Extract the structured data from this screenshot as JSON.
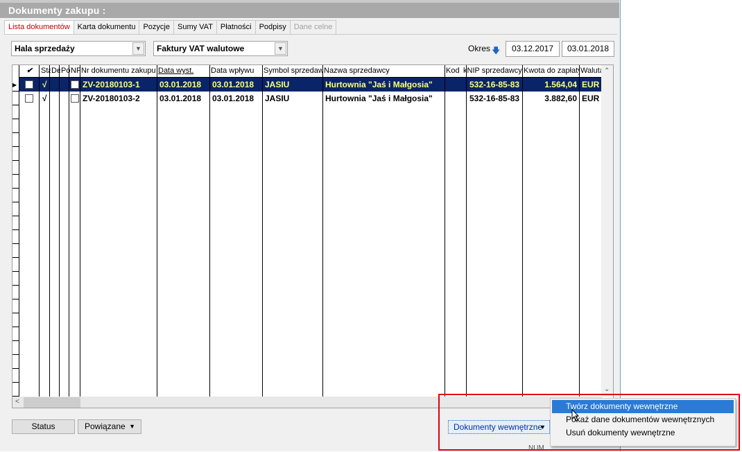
{
  "window": {
    "title": "Dokumenty zakupu :"
  },
  "tabs": [
    {
      "label": "Lista dokumentów"
    },
    {
      "label": "Karta dokumentu"
    },
    {
      "label": "Pozycje"
    },
    {
      "label": "Sumy VAT"
    },
    {
      "label": "Płatności"
    },
    {
      "label": "Podpisy"
    },
    {
      "label": "Dane celne"
    }
  ],
  "filters": {
    "location": "Hala sprzedaży",
    "doc_type": "Faktury VAT walutowe",
    "okres_label": "Okres",
    "date_from": "03.12.2017",
    "date_to": "03.01.2018"
  },
  "table": {
    "columns": [
      "✔",
      "Sta",
      "De",
      "Po",
      "NP",
      "Nr dokumentu zakupu",
      "Data wyst.",
      "Data wpływu",
      "Symbol sprzedawcy",
      "Nazwa sprzedawcy",
      "Kod",
      "kNIP sprzedawcy",
      "Kwota do zapłaty",
      "Waluta"
    ],
    "rows": [
      {
        "status": "√",
        "nr": "ZV-20180103-1",
        "data_wyst": "03.01.2018",
        "data_wplywu": "03.01.2018",
        "symbol": "JASIU",
        "nazwa": "Hurtownia \"Jaś i Małgosia\"",
        "kod": "",
        "nip": "532-16-85-83",
        "kwota": "1.564,04",
        "waluta": "EUR"
      },
      {
        "status": "√",
        "nr": "ZV-20180103-2",
        "data_wyst": "03.01.2018",
        "data_wplywu": "03.01.2018",
        "symbol": "JASIU",
        "nazwa": "Hurtownia \"Jaś i Małgosia\"",
        "kod": "",
        "nip": "532-16-85-83",
        "kwota": "3.882,60",
        "waluta": "EUR"
      }
    ]
  },
  "buttons": {
    "status": "Status",
    "powiazane": "Powiązane",
    "dokumenty": "Dokumenty wewnętrzne"
  },
  "menu": {
    "items": [
      "Twórz dokumenty wewnętrzne",
      "Pokaż dane dokumentów wewnętrznych",
      "Usuń dokumenty wewnętrzne"
    ]
  },
  "statusbar": {
    "num": "NUM"
  },
  "colors": {
    "selected_row": "#0a246a",
    "menu_highlight": "#2a7ad6",
    "callout": "#e0000e"
  }
}
